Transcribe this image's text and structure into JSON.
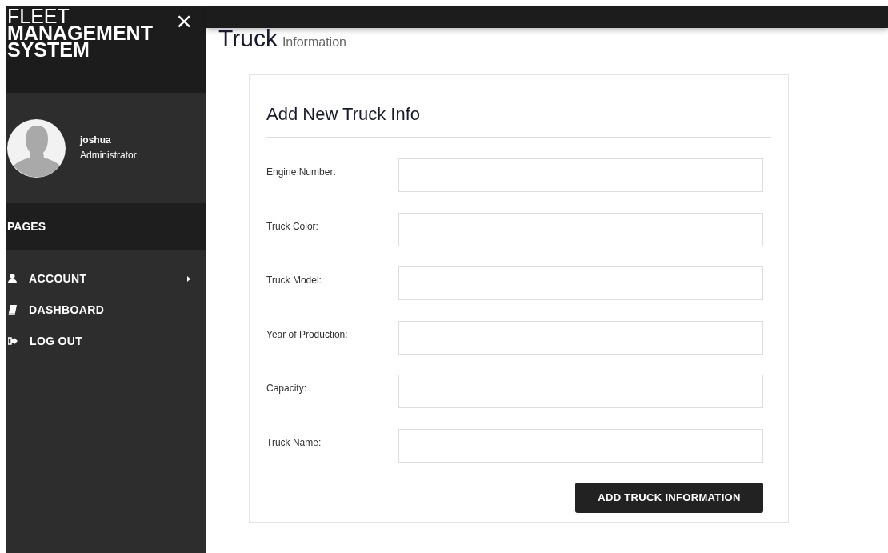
{
  "sidebar": {
    "brand": {
      "line1": "FLEET",
      "line2": "MANAGEMENT",
      "line3": "SYSTEM"
    },
    "close_symbol": "×",
    "user": {
      "name": "joshua",
      "role": "Administrator"
    },
    "section": "PAGES",
    "items": [
      {
        "label": "ACCOUNT",
        "kind": "user",
        "has_submenu": true
      },
      {
        "label": "DASHBOARD",
        "kind": "book",
        "has_submenu": false
      },
      {
        "label": "LOG OUT",
        "kind": "logout",
        "has_submenu": false
      }
    ]
  },
  "page": {
    "title": "Truck",
    "subtitle": "Information"
  },
  "form": {
    "title": "Add New Truck Info",
    "fields": [
      {
        "label": "Engine Number:"
      },
      {
        "label": "Truck Color:"
      },
      {
        "label": "Truck Model:"
      },
      {
        "label": "Year of Production:"
      },
      {
        "label": "Capacity:"
      },
      {
        "label": "Truck Name:"
      }
    ],
    "submit": "ADD TRUCK INFORMATION"
  }
}
